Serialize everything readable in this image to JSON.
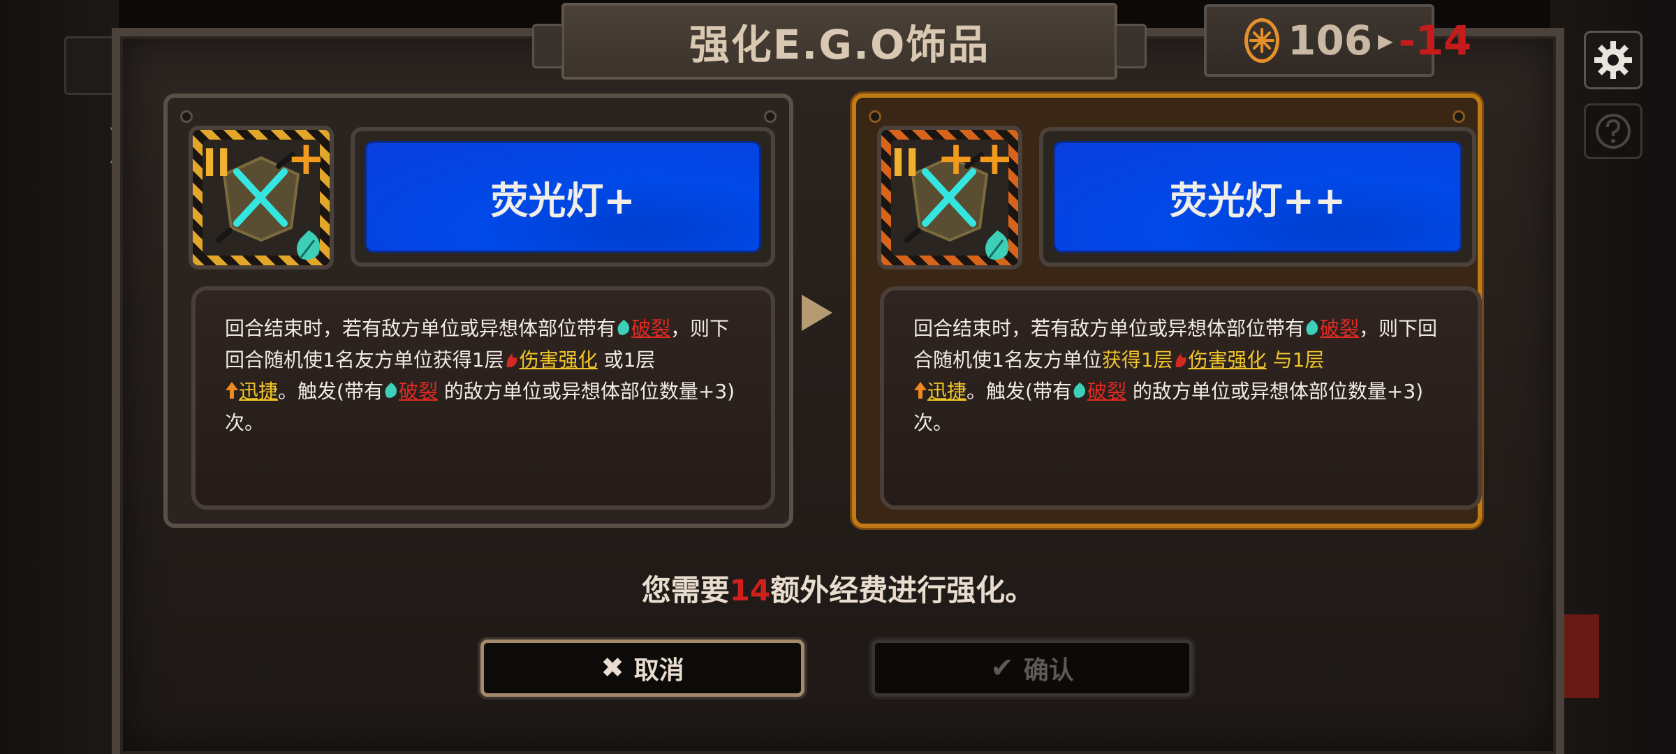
{
  "title": "强化E.G.O饰品",
  "cost": {
    "icon": "gear-wheel-icon",
    "current": "106",
    "delta": "-14",
    "delta_color": "#c61b1b",
    "accent_color": "#e5902a"
  },
  "left_card": {
    "tier": "II",
    "plus": "+",
    "name": "荧光灯+",
    "desc": {
      "p1": "回合结束时，若有敌方单位或异想体部位带有",
      "kw_rupture": "破裂",
      "p2": "，则下回合随机使1名友方单位获得1层",
      "kw_damage_up": "伤害强化",
      "p3": "或1层",
      "kw_haste": "迅捷",
      "p4": "。触发(带有",
      "kw_rupture2": "破裂",
      "p5": "的敌方单位或异想体部位数量+3)次。"
    }
  },
  "right_card": {
    "tier": "II",
    "plus": "++",
    "name": "荧光灯++",
    "desc": {
      "p1": "回合结束时，若有敌方单位或异想体部位带有",
      "kw_rupture": "破裂",
      "p2": "，则下回合随机使1名友方单位",
      "hl_gain": "获得1层",
      "kw_damage_up": "伤害强化",
      "hl_and": "与1层",
      "kw_haste": "迅捷",
      "p4": "。触发(带有",
      "kw_rupture2": "破裂",
      "p5": "的敌方单位或异想体部位数量+3)次。"
    }
  },
  "notice": {
    "prefix": "您需要",
    "amount": "14",
    "suffix": "额外经费进行强化。"
  },
  "buttons": {
    "cancel": "取消",
    "confirm": "确认"
  }
}
